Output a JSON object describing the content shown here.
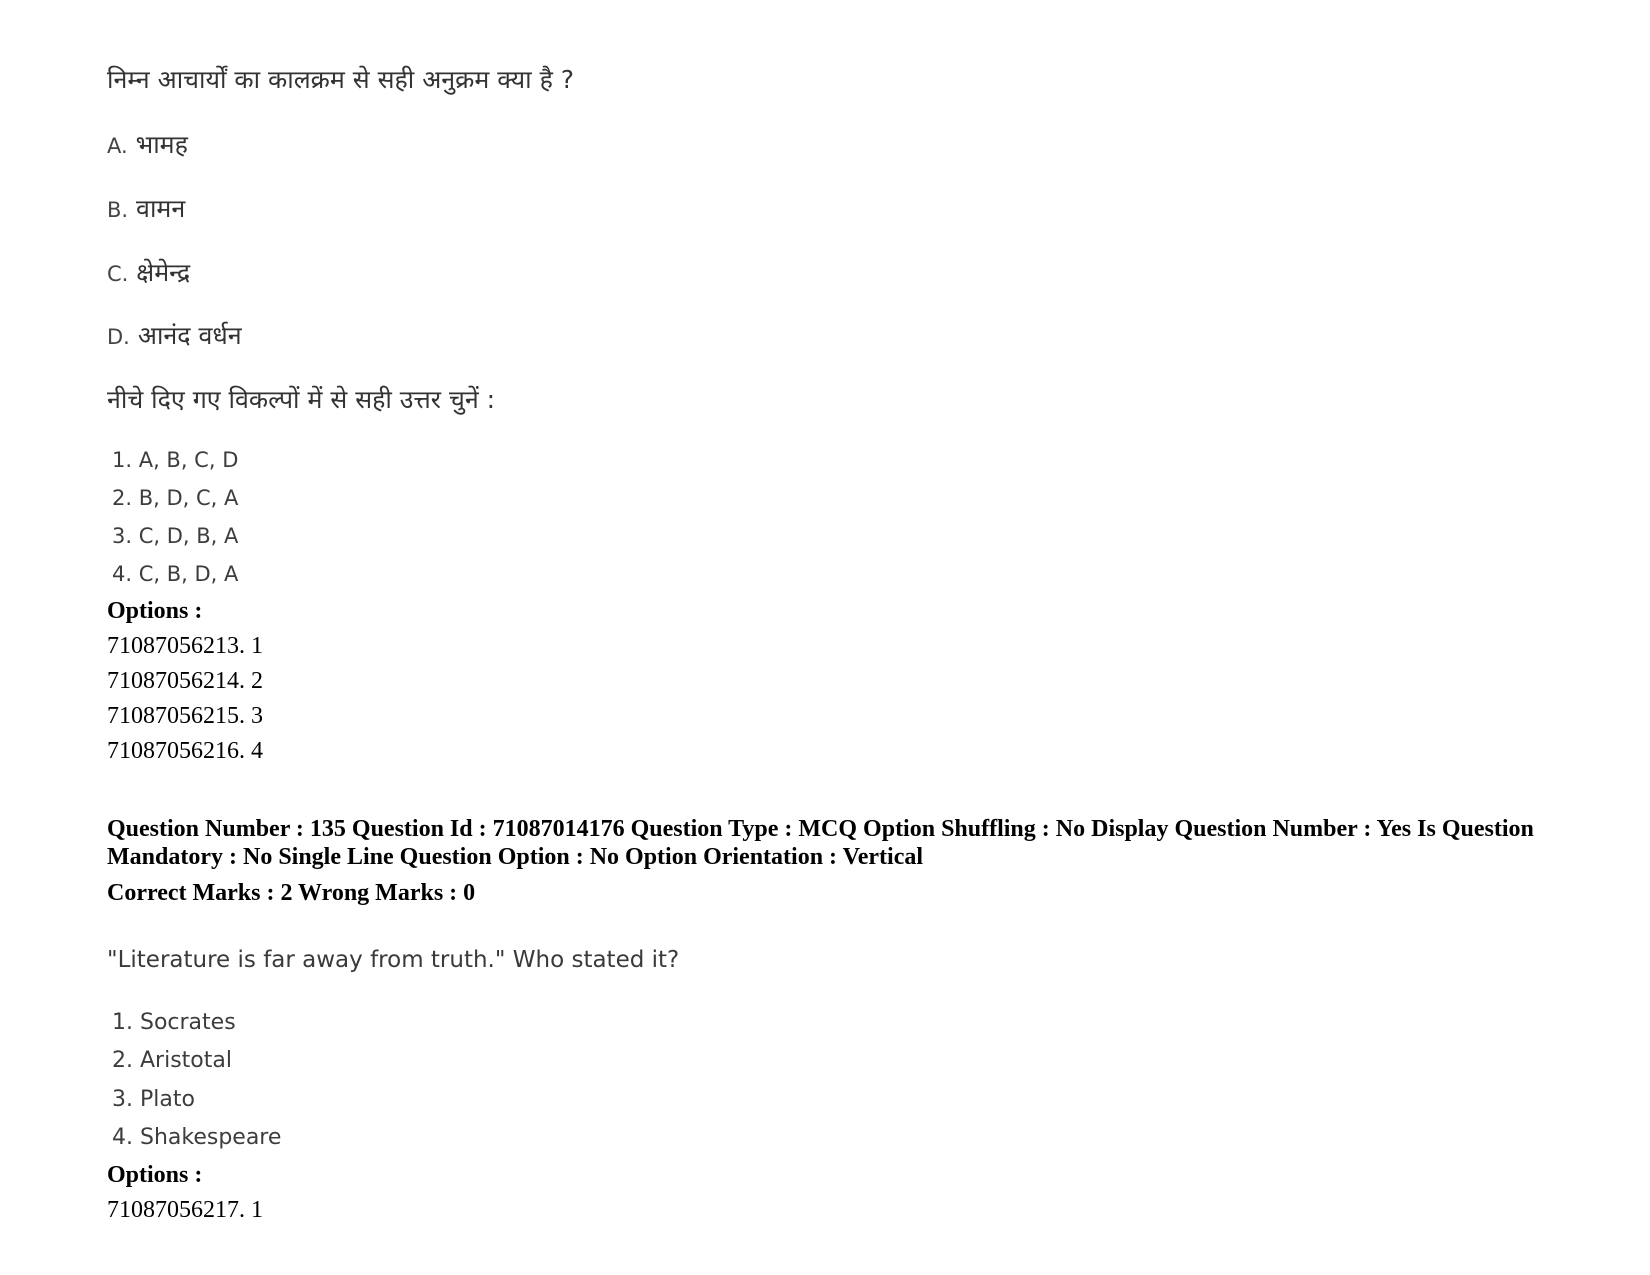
{
  "question_prev": {
    "stem": "निम्न आचार्यों का कालक्रम से सही अनुक्रम क्या है ?",
    "items": [
      {
        "label": "A.",
        "text": "भामह"
      },
      {
        "label": "B.",
        "text": "वामन"
      },
      {
        "label": "C.",
        "text": "क्षेमेन्द्र"
      },
      {
        "label": "D.",
        "text": "आनंद वर्धन"
      }
    ],
    "instruction": "नीचे दिए गए विकल्पों में से सही उत्तर चुनें :",
    "choices": [
      "1. A, B, C, D",
      "2. B, D, C, A",
      "3. C, D, B, A",
      "4. C, B, D, A"
    ],
    "options_label": "Options :",
    "option_ids": [
      "71087056213. 1",
      "71087056214. 2",
      "71087056215. 3",
      "71087056216. 4"
    ]
  },
  "question_135": {
    "meta_line": "Question Number : 135 Question Id : 71087014176 Question Type : MCQ Option Shuffling : No Display Question Number : Yes Is Question Mandatory : No Single Line Question Option : No Option Orientation : Vertical",
    "marks_line": "Correct Marks : 2 Wrong Marks : 0",
    "stem": "\"Literature is far away from truth.\" Who stated it?",
    "choices": [
      "1. Socrates",
      "2. Aristotal",
      "3. Plato",
      "4. Shakespeare"
    ],
    "options_label": "Options :",
    "option_ids": [
      "71087056217. 1"
    ]
  }
}
